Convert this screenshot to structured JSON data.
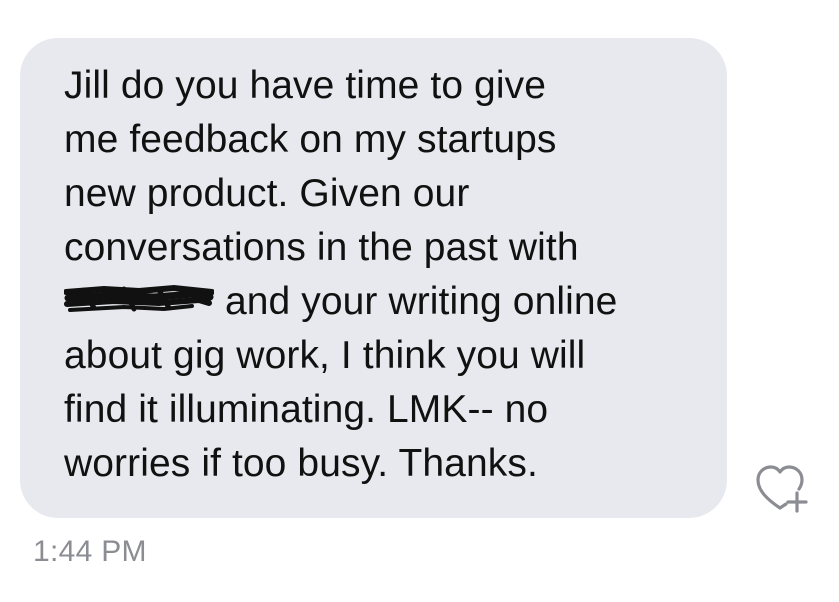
{
  "message": {
    "lines": [
      "Jill do you have time to give",
      "me feedback on my startups",
      "new product. Given our",
      "conversations in the past with",
      "and your writing online",
      "about gig work, I think you will",
      "find it illuminating.  LMK-- no",
      "worries if too busy. Thanks."
    ],
    "timestamp": "1:44 PM"
  },
  "icons": {
    "reaction": "heart-plus-icon",
    "redaction": "redaction-scribble"
  },
  "colors": {
    "bubble": "#e8e9ee",
    "text": "#111111",
    "timestamp": "#8b8d93",
    "icon": "#8b8d93"
  }
}
